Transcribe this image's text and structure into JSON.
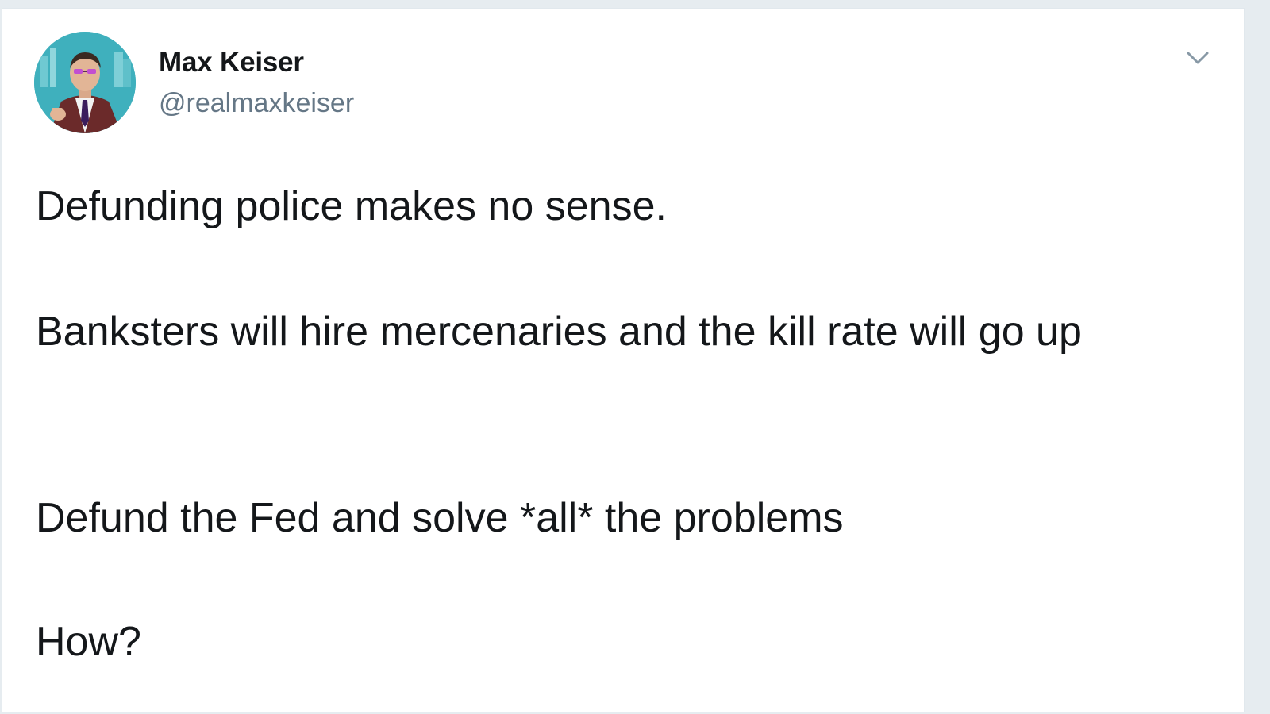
{
  "tweet": {
    "author": {
      "display_name": "Max Keiser",
      "handle": "@realmaxkeiser",
      "avatar_icon": "profile-photo"
    },
    "menu_icon": "chevron-down-icon",
    "paragraphs": [
      "Defunding police makes no sense.",
      "Banksters will hire mercenaries and the kill rate will go up",
      "Defund the Fed and solve *all* the problems",
      "How?"
    ]
  },
  "colors": {
    "name": "#14171a",
    "handle": "#657786",
    "border": "#e1e8ed",
    "caret": "#8899a6"
  }
}
